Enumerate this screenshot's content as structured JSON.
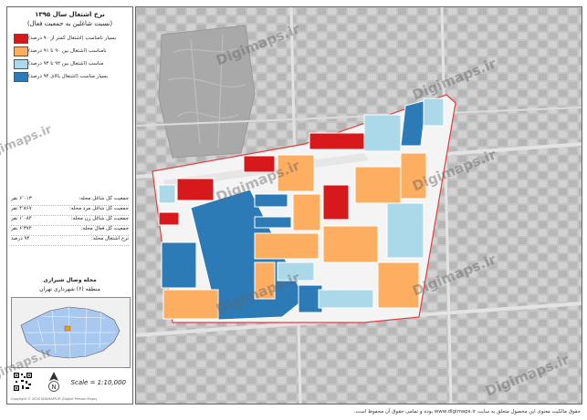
{
  "title": "نرخ اشتغال سال ۱۳۹۵",
  "subtitle": "(نسبت شاغلین به جمعیت فعال)",
  "legend": [
    {
      "label": "بسیار نامناسب (اشتغال کمتر از ۹۰ درصد)",
      "color": "#d7191c"
    },
    {
      "label": "نامناسب (اشتغال بین ۹۰ تا ۹۱ درصد)",
      "color": "#fdae61"
    },
    {
      "label": "مناسب (اشتغال بین ۹۲ تا ۹۴ درصد)",
      "color": "#abd9e9"
    },
    {
      "label": "بسیار مناسب (اشتغال بالای ۹۴ درصد)",
      "color": "#2c7bb6"
    }
  ],
  "stats": [
    {
      "label": "جمعیت کل شاغل محله:",
      "value": "۶٬۰۱۳ نفر"
    },
    {
      "label": "جمعیت کل شاغل مرد محله:",
      "value": "۴٬۸۶۷ نفر"
    },
    {
      "label": "جمعیت کل شاغل زن محله:",
      "value": "۱٬۰۸۴ نفر"
    },
    {
      "label": "جمعیت کل فعال محله:",
      "value": "۶٬۳۷۴ نفر"
    },
    {
      "label": "نرخ اشتغال محله:",
      "value": "۹۴ درصد"
    }
  ],
  "area_name": "محله وصال شیرازی",
  "area_district": "منطقه (۶) شهرداری تهران",
  "scale": "Scale = 1:10,000",
  "north_label": "N",
  "copyright": "Copyright © 2018 DIGIMAPS.IR (Digital Persian Maps)",
  "watermark": "Digimaps.ir",
  "bottom_note": "حقوق مالکیت معنوی این محصول متعلق به سایت www.digimaps.ir بوده و تمامی حقوق آن محفوظ است."
}
